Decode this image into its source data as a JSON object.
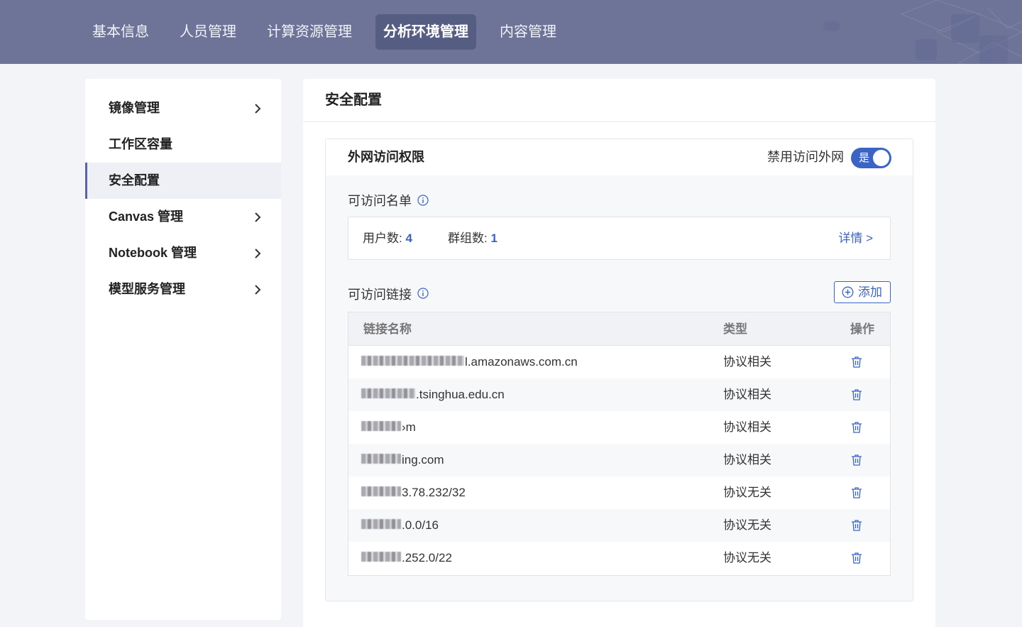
{
  "topnav": {
    "items": [
      "基本信息",
      "人员管理",
      "计算资源管理",
      "分析环境管理",
      "内容管理"
    ],
    "active_index": 3
  },
  "sidebar": {
    "items": [
      {
        "label": "镜像管理",
        "has_arrow": true
      },
      {
        "label": "工作区容量",
        "has_arrow": false
      },
      {
        "label": "安全配置",
        "has_arrow": false
      },
      {
        "label": "Canvas 管理",
        "has_arrow": true
      },
      {
        "label": "Notebook 管理",
        "has_arrow": true
      },
      {
        "label": "模型服务管理",
        "has_arrow": true
      }
    ],
    "active_index": 2
  },
  "main": {
    "title": "安全配置",
    "card": {
      "title": "外网访问权限",
      "toggle_label": "禁用访问外网",
      "toggle_text": "是",
      "toggle_on": true,
      "whitelist": {
        "label": "可访问名单",
        "users_label": "用户数: ",
        "users_count": "4",
        "groups_label": "群组数: ",
        "groups_count": "1",
        "detail_link": "详情 >"
      },
      "links": {
        "label": "可访问链接",
        "add_button": "添加",
        "columns": [
          "链接名称",
          "类型",
          "操作"
        ],
        "rows": [
          {
            "name": "l.amazonaws.com.cn",
            "type": "协议相关"
          },
          {
            "name": ".tsinghua.edu.cn",
            "type": "协议相关"
          },
          {
            "name": "›m",
            "type": "协议相关"
          },
          {
            "name": "ing.com",
            "type": "协议相关"
          },
          {
            "name": "3.78.232/32",
            "type": "协议无关"
          },
          {
            "name": ".0.0/16",
            "type": "协议无关"
          },
          {
            "name": ".252.0/22",
            "type": "协议无关"
          }
        ]
      }
    }
  },
  "colors": {
    "nav_bg": "#6d7498",
    "nav_active_bg": "#565d83",
    "accent": "#3a64c6",
    "sidebar_active_bar": "#5b63a0"
  }
}
